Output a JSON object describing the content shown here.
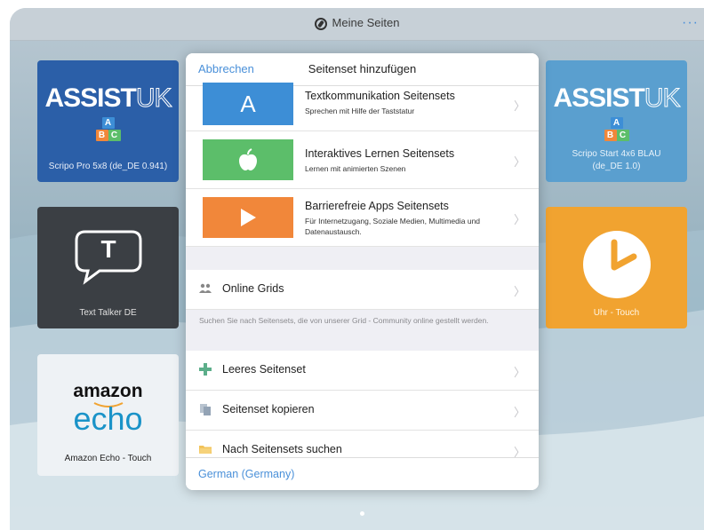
{
  "topbar": {
    "title": "Meine Seiten",
    "more_label": "···"
  },
  "tiles": [
    {
      "name": "scripo-pro",
      "label": "Scripo Pro 5x8 (de_DE 0.941)",
      "brand": "ASSIST",
      "brand_thin": "UK"
    },
    {
      "name": "scripo-start",
      "label": "Scripo Start 4x6 BLAU (de_DE 1.0)",
      "brand": "ASSIST",
      "brand_thin": "UK"
    },
    {
      "name": "text-talker",
      "label": "Text Talker DE",
      "glyph": "T"
    },
    {
      "name": "uhr-touch",
      "label": "Uhr - Touch"
    },
    {
      "name": "amazon-echo",
      "label": "Amazon Echo - Touch",
      "logo_top": "amazon",
      "logo_bottom": "echo"
    }
  ],
  "blocks": [
    "A",
    "B",
    "C"
  ],
  "modal": {
    "cancel": "Abbrechen",
    "title": "Seitenset hinzufügen",
    "sets": [
      {
        "title": "Textkommunikation Seitensets",
        "sub": "Sprechen mit Hilfe der Taststatur",
        "color": "#3d8ed6",
        "glyph": "A"
      },
      {
        "title": "Interaktives Lernen Seitensets",
        "sub": "Lernen mit animierten Szenen",
        "color": "#5cbe6a"
      },
      {
        "title": "Barrierefreie Apps Seitensets",
        "sub": "Für Internetzugang, Soziale Medien, Multimedia und Datenaustausch.",
        "color": "#f1873a"
      }
    ],
    "online": {
      "label": "Online Grids",
      "note": "Suchen Sie nach Seitensets, die von unserer Grid - Community online gestellt werden."
    },
    "items": [
      {
        "label": "Leeres Seitenset"
      },
      {
        "label": "Seitenset kopieren"
      },
      {
        "label": "Nach Seitensets suchen"
      }
    ],
    "language": "German (Germany)"
  },
  "colors": {
    "accent": "#4a90d9",
    "tile_blue": "#2b5fa8",
    "tile_lightblue": "#5a9fcf",
    "tile_dark": "#3b3f44",
    "tile_orange": "#f1a330"
  }
}
